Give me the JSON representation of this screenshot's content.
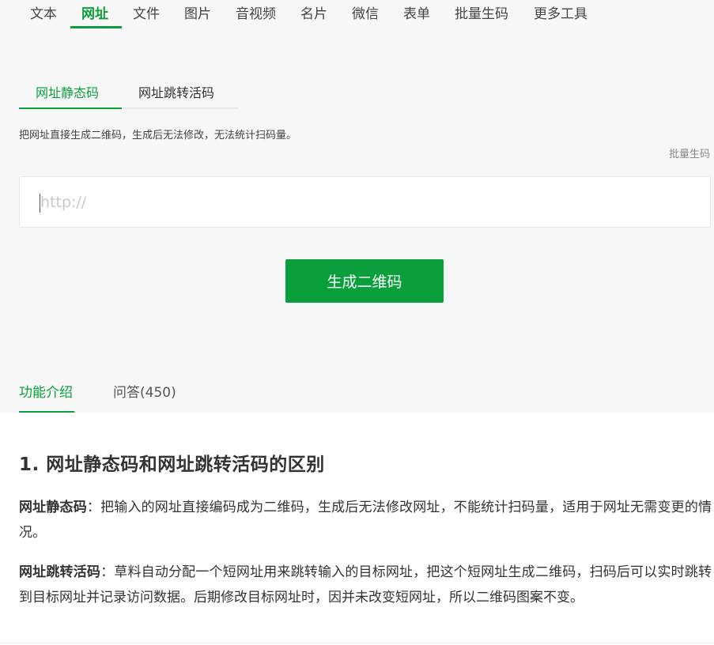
{
  "top_tabs": [
    "文本",
    "网址",
    "文件",
    "图片",
    "音视频",
    "名片",
    "微信",
    "表单",
    "批量生码",
    "更多工具"
  ],
  "active_top_tab": "网址",
  "sub_tabs": [
    "网址静态码",
    "网址跳转活码"
  ],
  "active_sub_tab": "网址静态码",
  "description": "把网址直接生成二维码，生成后无法修改，无法统计扫码量。",
  "batch_link": "批量生码",
  "url_input": {
    "placeholder": "http://",
    "value": ""
  },
  "generate_button": "生成二维码",
  "intro_tabs": [
    "功能介绍",
    "问答(450)"
  ],
  "active_intro_tab": "功能介绍",
  "section_title": "1. 网址静态码和网址跳转活码的区别",
  "paragraphs": [
    {
      "term": "网址静态码",
      "text": "：把输入的网址直接编码成为二维码，生成后无法修改网址，不能统计扫码量，适用于网址无需变更的情况。"
    },
    {
      "term": "网址跳转活码",
      "text": "：草料自动分配一个短网址用来跳转输入的目标网址，把这个短网址生成二维码，扫码后可以实时跳转到目标网址并记录访问数据。后期修改目标网址时，因并未改变短网址，所以二维码图案不变。"
    }
  ],
  "colors": {
    "accent": "#0a9f3c",
    "background": "#f7f7f7"
  }
}
